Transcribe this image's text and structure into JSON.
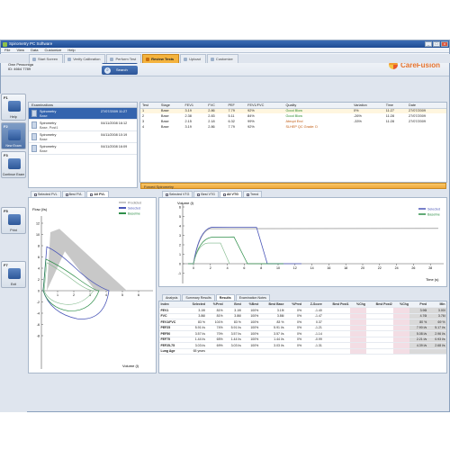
{
  "window": {
    "title": "Spirometry PC Software",
    "controls": [
      "_",
      "□",
      "x"
    ]
  },
  "menu": [
    "File",
    "View",
    "Data",
    "Customize",
    "Help"
  ],
  "patient": {
    "label": "Patient",
    "name": "Own Pessoniga",
    "id": "ID: 4664 7789"
  },
  "patient_buttons": {
    "new": "New",
    "search": "Search"
  },
  "brand": {
    "name": "CareFusion",
    "color": "#e6722b"
  },
  "tabs": [
    {
      "label": "Start Screen"
    },
    {
      "label": "Verify Calibration"
    },
    {
      "label": "Perform Test"
    },
    {
      "label": "Review Tests",
      "active": true
    },
    {
      "label": "Upload"
    },
    {
      "label": "Customize"
    }
  ],
  "sidebar": [
    {
      "key": "F1",
      "label": "Help"
    },
    {
      "key": "F2",
      "label": "New Exam"
    },
    {
      "key": "F3",
      "label": "Continue Exam"
    },
    {
      "key": "F5",
      "label": "Print"
    },
    {
      "key": "F7",
      "label": "Exit"
    }
  ],
  "examinations": {
    "header": "Examinations",
    "items": [
      {
        "title": "Spirometry",
        "sub": "Base",
        "date": "27/07/2009 11:27",
        "selected": true
      },
      {
        "title": "Spirometry",
        "sub": "Base, Post1",
        "date": "04/11/2008 16:12"
      },
      {
        "title": "Spirometry",
        "sub": "Base",
        "date": "04/11/2008 10:19"
      },
      {
        "title": "Spirometry",
        "sub": "Base",
        "date": "04/11/2008 16:09"
      }
    ]
  },
  "tests": {
    "columns": [
      "Test",
      "Stage",
      "FEV1",
      "FVC",
      "PEF",
      "FEV1/FVC",
      "Quality",
      "Variation",
      "Time",
      "Date"
    ],
    "rows": [
      [
        "1",
        "Base",
        "3.19",
        "2.86",
        "7.79",
        "92%",
        "Good Blow",
        "0%",
        "11:27",
        "27/07/2009"
      ],
      [
        "2",
        "Base",
        "2.38",
        "2.83",
        "5.11",
        "84%",
        "Good Blow",
        "-26%",
        "11:28",
        "27/07/2009"
      ],
      [
        "3",
        "Base",
        "2.15",
        "2.18",
        "6.32",
        "99%",
        "Abrupt End",
        "-33%",
        "11:28",
        "27/07/2009"
      ],
      [
        "4",
        "Base",
        "3.19",
        "2.86",
        "7.79",
        "92%",
        "SLHEP QC Grade: D",
        "",
        "",
        ""
      ]
    ]
  },
  "forced_label": "Forced Spirometry",
  "fv_tabs": [
    "Selected FVL",
    "Best FVL",
    "All FVL"
  ],
  "vt_tabs": [
    "Selected VTG",
    "Best VTG",
    "All VTG",
    "Trend"
  ],
  "fv_chart": {
    "ylabel": "Flow (l/s)",
    "xlabel": "Volume (l)",
    "legend": [
      "Predicted",
      "Selected",
      "Baseline"
    ],
    "y_ticks": [
      "12",
      "10",
      "8",
      "6",
      "4",
      "2",
      "0",
      "-2",
      "-4",
      "-6",
      "-8"
    ],
    "x_ticks": [
      "1",
      "2",
      "3",
      "4",
      "5",
      "6"
    ]
  },
  "vt_chart": {
    "ylabel": "Volume (l)",
    "xlabel": "Time (s)",
    "legend": [
      "Selected",
      "Baseline"
    ],
    "y_ticks": [
      "6",
      "5",
      "4",
      "3",
      "2",
      "1",
      "0",
      "-1"
    ],
    "x_ticks": [
      "0",
      "2",
      "4",
      "6",
      "8",
      "10",
      "12",
      "14",
      "16",
      "18",
      "20",
      "22",
      "24",
      "26",
      "28",
      "30"
    ]
  },
  "result_tabs": [
    "Analysis",
    "Summary Results",
    "Results",
    "Examination Notes"
  ],
  "results": {
    "columns": [
      "Index",
      "Selected",
      "%Pred",
      "Best",
      "%Best",
      "Best Base",
      "%Pred",
      "Z-Score",
      "Best Post1",
      "%Chg",
      "Best Post2",
      "%Chg",
      "Pred",
      "Min"
    ],
    "rows": [
      [
        "FEV1",
        "3.19l",
        "81%",
        "3.19l",
        "100%",
        "3.19l",
        "0%",
        "-1.40",
        "",
        "",
        "",
        "",
        "3.96l",
        "3.00l"
      ],
      [
        "FVC",
        "3.86l",
        "81%",
        "3.86l",
        "100%",
        "3.86l",
        "0%",
        "-1.47",
        "",
        "",
        "",
        "",
        "4.76l",
        "3.76l"
      ],
      [
        "FEV1/FVC",
        "83 %",
        "101%",
        "83 %",
        "100%",
        "83 %",
        "0%",
        "0.37",
        "",
        "",
        "",
        "",
        "80 %",
        "69 %"
      ],
      [
        "PEF25",
        "5.91 l/s",
        "74%",
        "5.91 l/s",
        "100%",
        "5.91 l/s",
        "0%",
        "-1.21",
        "",
        "",
        "",
        "",
        "7.90 l/s",
        "5.17 l/s"
      ],
      [
        "PEF50",
        "3.57 l/s",
        "70%",
        "3.57 l/s",
        "100%",
        "3.57 l/s",
        "0%",
        "-1.14",
        "",
        "",
        "",
        "",
        "5.08 l/s",
        "2.96 l/s"
      ],
      [
        "FEF75",
        "1.44 l/s",
        "65%",
        "1.44 l/s",
        "100%",
        "1.44 l/s",
        "0%",
        "-0.99",
        "",
        "",
        "",
        "",
        "2.21 l/s",
        "0.93 l/s"
      ],
      [
        "FEF25-75",
        "3.03 l/s",
        "69%",
        "3.03 l/s",
        "100%",
        "3.03 l/s",
        "0%",
        "-1.31",
        "",
        "",
        "",
        "",
        "4.39 l/s",
        "2.68 l/s"
      ],
      [
        "Lung Age",
        "65 years",
        "",
        "",
        "",
        "",
        "",
        "",
        "",
        "",
        "",
        "",
        "",
        ""
      ]
    ]
  },
  "colors": {
    "selected": "#4a56b8",
    "baseline": "#2f8f4a",
    "predicted": "#c8c8c8",
    "accent": "#f4b33e"
  }
}
